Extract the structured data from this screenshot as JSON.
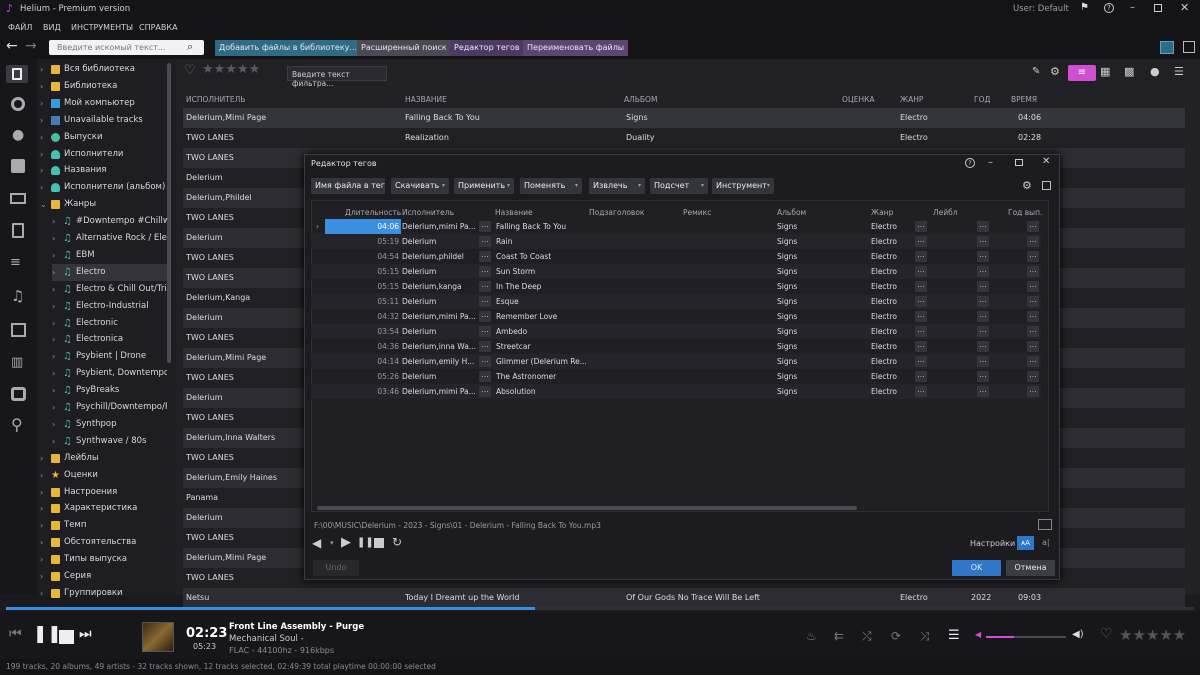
{
  "app": {
    "title": "Helium - Premium version",
    "user": "User: Default"
  },
  "menu": [
    "ФАЙЛ",
    "ВИД",
    "ИНСТРУМЕНТЫ",
    "СПРАВКА"
  ],
  "toolbar": {
    "search_placeholder": "Введите искомый текст...",
    "buttons": [
      "Добавить файлы в библиотеку...",
      "Расширенный поиск",
      "Редактор тегов",
      "Переименовать файлы"
    ],
    "filter_placeholder": "Введите текст фильтра..."
  },
  "sidebar": [
    {
      "label": "Вся библиотека",
      "level": 0,
      "icon": "folder"
    },
    {
      "label": "Библиотека",
      "level": 0,
      "icon": "folder"
    },
    {
      "label": "Мой компьютер",
      "level": 0,
      "icon": "monitor"
    },
    {
      "label": "Unavailable tracks",
      "level": 0,
      "icon": "blue"
    },
    {
      "label": "Выпуски",
      "level": 0,
      "icon": "disc"
    },
    {
      "label": "Исполнители",
      "level": 0,
      "icon": "person"
    },
    {
      "label": "Названия",
      "level": 0,
      "icon": "person"
    },
    {
      "label": "Исполнители (альбом)",
      "level": 0,
      "icon": "person"
    },
    {
      "label": "Жанры",
      "level": 0,
      "icon": "folder",
      "open": true
    },
    {
      "label": "#Downtempo #Chillwa",
      "level": 1,
      "icon": "note"
    },
    {
      "label": "Alternative Rock / Elect",
      "level": 1,
      "icon": "note"
    },
    {
      "label": "EBM",
      "level": 1,
      "icon": "note"
    },
    {
      "label": "Electro",
      "level": 1,
      "icon": "note",
      "selected": true
    },
    {
      "label": "Electro & Chill Out/Trip",
      "level": 1,
      "icon": "note"
    },
    {
      "label": "Electro-Industrial",
      "level": 1,
      "icon": "note"
    },
    {
      "label": "Electronic",
      "level": 1,
      "icon": "note"
    },
    {
      "label": "Electronica",
      "level": 1,
      "icon": "note"
    },
    {
      "label": "Psybient | Drone",
      "level": 1,
      "icon": "note"
    },
    {
      "label": "Psybient, Downtempo,",
      "level": 1,
      "icon": "note"
    },
    {
      "label": "PsyBreaks",
      "level": 1,
      "icon": "note"
    },
    {
      "label": "Psychill/Downtempo/P",
      "level": 1,
      "icon": "note"
    },
    {
      "label": "Synthpop",
      "level": 1,
      "icon": "note"
    },
    {
      "label": "Synthwave / 80s",
      "level": 1,
      "icon": "note"
    },
    {
      "label": "Лейблы",
      "level": 0,
      "icon": "folder"
    },
    {
      "label": "Оценки",
      "level": 0,
      "icon": "star"
    },
    {
      "label": "Настроения",
      "level": 0,
      "icon": "folder"
    },
    {
      "label": "Характеристика",
      "level": 0,
      "icon": "folder"
    },
    {
      "label": "Темп",
      "level": 0,
      "icon": "folder"
    },
    {
      "label": "Обстоятельства",
      "level": 0,
      "icon": "folder"
    },
    {
      "label": "Типы выпуска",
      "level": 0,
      "icon": "folder"
    },
    {
      "label": "Серия",
      "level": 0,
      "icon": "folder"
    },
    {
      "label": "Группировки",
      "level": 0,
      "icon": "folder"
    }
  ],
  "table": {
    "columns": [
      "ИСПОЛНИТЕЛЬ",
      "НАЗВАНИЕ",
      "АЛЬБОМ",
      "ОЦЕНКА",
      "ЖАНР",
      "ГОД",
      "ВРЕМЯ"
    ],
    "rows": [
      {
        "artist": "Delerium,Mimi Page",
        "title": "Falling Back To You",
        "album": "Signs",
        "genre": "Electro",
        "year": "",
        "time": "04:06"
      },
      {
        "artist": "TWO LANES",
        "title": "Realization",
        "album": "Duality",
        "genre": "Electro",
        "year": "",
        "time": "02:28"
      },
      {
        "artist": "TWO LANES",
        "title": "",
        "album": "",
        "genre": "",
        "year": "",
        "time": ""
      },
      {
        "artist": "Delerium",
        "title": "",
        "album": "",
        "genre": "",
        "year": "",
        "time": ""
      },
      {
        "artist": "Delerium,Phildel",
        "title": "",
        "album": "",
        "genre": "",
        "year": "",
        "time": ""
      },
      {
        "artist": "TWO LANES",
        "title": "",
        "album": "",
        "genre": "",
        "year": "",
        "time": ""
      },
      {
        "artist": "Delerium",
        "title": "",
        "album": "",
        "genre": "",
        "year": "",
        "time": ""
      },
      {
        "artist": "TWO LANES",
        "title": "",
        "album": "",
        "genre": "",
        "year": "",
        "time": ""
      },
      {
        "artist": "TWO LANES",
        "title": "",
        "album": "",
        "genre": "",
        "year": "",
        "time": ""
      },
      {
        "artist": "Delerium,Kanga",
        "title": "",
        "album": "",
        "genre": "",
        "year": "",
        "time": ""
      },
      {
        "artist": "Delerium",
        "title": "",
        "album": "",
        "genre": "",
        "year": "",
        "time": ""
      },
      {
        "artist": "TWO LANES",
        "title": "",
        "album": "",
        "genre": "",
        "year": "",
        "time": ""
      },
      {
        "artist": "Delerium,Mimi Page",
        "title": "",
        "album": "",
        "genre": "",
        "year": "",
        "time": ""
      },
      {
        "artist": "TWO LANES",
        "title": "",
        "album": "",
        "genre": "",
        "year": "",
        "time": ""
      },
      {
        "artist": "Delerium",
        "title": "",
        "album": "",
        "genre": "",
        "year": "",
        "time": ""
      },
      {
        "artist": "TWO LANES",
        "title": "",
        "album": "",
        "genre": "",
        "year": "",
        "time": ""
      },
      {
        "artist": "Delerium,Inna Walters",
        "title": "",
        "album": "",
        "genre": "",
        "year": "",
        "time": ""
      },
      {
        "artist": "TWO LANES",
        "title": "",
        "album": "",
        "genre": "",
        "year": "",
        "time": ""
      },
      {
        "artist": "Delerium,Emily Haines",
        "title": "",
        "album": "",
        "genre": "",
        "year": "",
        "time": ""
      },
      {
        "artist": "Panama",
        "title": "",
        "album": "",
        "genre": "",
        "year": "",
        "time": ""
      },
      {
        "artist": "Delerium",
        "title": "",
        "album": "",
        "genre": "",
        "year": "",
        "time": ""
      },
      {
        "artist": "TWO LANES",
        "title": "",
        "album": "",
        "genre": "",
        "year": "",
        "time": ""
      },
      {
        "artist": "Delerium,Mimi Page",
        "title": "",
        "album": "",
        "genre": "",
        "year": "",
        "time": ""
      },
      {
        "artist": "TWO LANES",
        "title": "",
        "album": "",
        "genre": "",
        "year": "",
        "time": ""
      },
      {
        "artist": "Netsu",
        "title": "Today I Dreamt up the World",
        "album": "Of Our Gods No Trace Will Be Left",
        "genre": "Electro",
        "year": "2022",
        "time": "09:03"
      }
    ]
  },
  "dialog": {
    "title": "Редактор тегов",
    "toolbar": [
      "Имя файла в тег",
      "Скачивать",
      "Применить",
      "Поменять",
      "Извлечь",
      "Подсчет",
      "Инструмент"
    ],
    "columns": [
      "Длительность",
      "Исполнитель",
      "Название",
      "Подзаголовок",
      "Ремикс",
      "Альбом",
      "Жанр",
      "Лейбл",
      "Год вып."
    ],
    "rows": [
      {
        "dur": "04:06",
        "artist": "Delerium,mimi Pa...",
        "title": "Falling Back To You",
        "album": "Signs",
        "genre": "Electro"
      },
      {
        "dur": "05:19",
        "artist": "Delerium",
        "title": "Rain",
        "album": "Signs",
        "genre": "Electro"
      },
      {
        "dur": "04:54",
        "artist": "Delerium,phildel",
        "title": "Coast To Coast",
        "album": "Signs",
        "genre": "Electro"
      },
      {
        "dur": "05:15",
        "artist": "Delerium",
        "title": "Sun Storm",
        "album": "Signs",
        "genre": "Electro"
      },
      {
        "dur": "05:15",
        "artist": "Delerium,kanga",
        "title": "In The Deep",
        "album": "Signs",
        "genre": "Electro"
      },
      {
        "dur": "05:11",
        "artist": "Delerium",
        "title": "Esque",
        "album": "Signs",
        "genre": "Electro"
      },
      {
        "dur": "04:32",
        "artist": "Delerium,mimi Pa...",
        "title": "Remember Love",
        "album": "Signs",
        "genre": "Electro"
      },
      {
        "dur": "03:54",
        "artist": "Delerium",
        "title": "Ambedo",
        "album": "Signs",
        "genre": "Electro"
      },
      {
        "dur": "04:36",
        "artist": "Delerium,inna Wa...",
        "title": "Streetcar",
        "album": "Signs",
        "genre": "Electro"
      },
      {
        "dur": "04:14",
        "artist": "Delerium,emily H...",
        "title": "Glimmer (Delerium Re...",
        "album": "Signs",
        "genre": "Electro"
      },
      {
        "dur": "05:26",
        "artist": "Delerium",
        "title": "The Astronomer",
        "album": "Signs",
        "genre": "Electro"
      },
      {
        "dur": "03:46",
        "artist": "Delerium,mimi Pa...",
        "title": "Absolution",
        "album": "Signs",
        "genre": "Electro"
      }
    ],
    "dots": "...",
    "filepath": "F:\\00\\MUSIC\\Delerium - 2023 - Signs\\01 - Delerium - Falling Back To You.mp3",
    "settings_label": "Настройки",
    "undo": "Undo",
    "ok": "OK",
    "cancel": "Отмена"
  },
  "player": {
    "track": "Front Line Assembly - Purge",
    "album": "Mechanical Soul -",
    "format": "FLAC - 44100hz - 916kbps",
    "elapsed": "02:23",
    "total": "05:23",
    "progress": 0.445,
    "volume": 0.35
  },
  "status": "199 tracks, 20 albums, 49 artists - 32 tracks shown, 12 tracks selected, 02:49:39 total playtime 00:00:00 selected",
  "colors": {
    "accent": "#d04ed4",
    "progress": "#3b8fe0",
    "teal": "#2f6b87",
    "selected": "#2c2c34"
  }
}
